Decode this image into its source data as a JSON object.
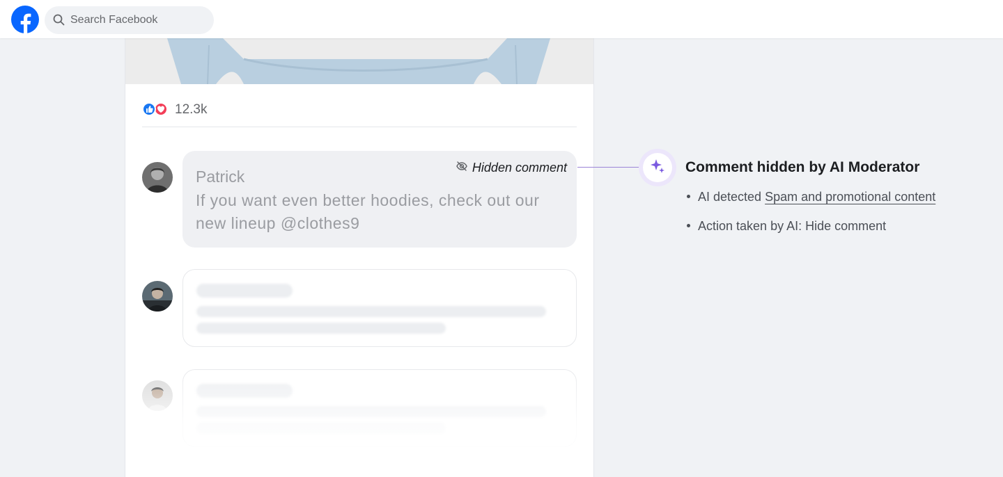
{
  "topbar": {
    "search_placeholder": "Search Facebook"
  },
  "post": {
    "reaction_count": "12.3k",
    "reactions": [
      "like-icon",
      "love-icon"
    ],
    "hidden_comment": {
      "tag": "Hidden comment",
      "author": "Patrick",
      "text": "If you want even better hoodies, check out our new lineup @clothes9"
    }
  },
  "ai_panel": {
    "title": "Comment hidden by AI Moderator",
    "detected_prefix": "AI detected",
    "detected_link": "Spam and promotional content",
    "action": "Action taken by AI: Hide comment"
  },
  "colors": {
    "facebook_blue": "#0866ff",
    "ai_accent": "#7a5ae0",
    "connector": "#9b84d6"
  }
}
